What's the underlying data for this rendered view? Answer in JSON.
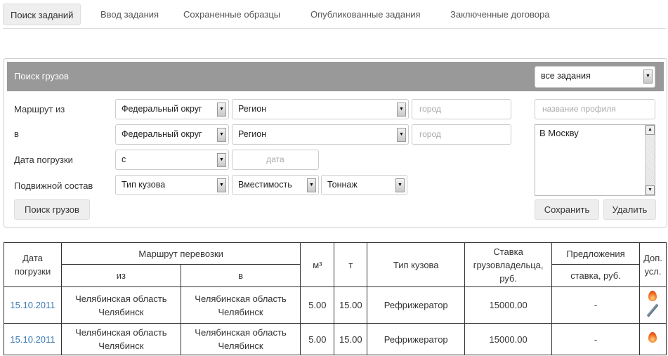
{
  "tabs": [
    "Поиск заданий",
    "Ввод задания",
    "Сохраненные образцы",
    "Опубликованные задания",
    "Заключенные договора"
  ],
  "panel": {
    "title": "Поиск грузов",
    "scope_select": "все задания",
    "labels": {
      "from": "Маршрут из",
      "to": "в",
      "date": "Дата погрузки",
      "rolling": "Подвижной состав"
    },
    "from": {
      "district": "Федеральный округ",
      "region": "Регион",
      "city_placeholder": "город"
    },
    "to": {
      "district": "Федеральный округ",
      "region": "Регион",
      "city_placeholder": "город"
    },
    "date": {
      "mode": "с",
      "placeholder": "дата"
    },
    "rolling": {
      "body": "Тип кузова",
      "capacity": "Вместимость",
      "tonnage": "Тоннаж"
    },
    "search_button": "Поиск грузов",
    "profile_placeholder": "название профиля",
    "profiles": "В Москву",
    "save_button": "Сохранить",
    "delete_button": "Удалить"
  },
  "table": {
    "headers": {
      "date": "Дата погрузки",
      "route": "Маршрут перевозки",
      "from": "из",
      "to": "в",
      "volume": "м³",
      "weight": "т",
      "body": "Тип кузова",
      "rate": "Ставка грузовладельца, руб.",
      "offers": "Предложения",
      "offers_rate": "ставка, руб.",
      "extra": "Доп. усл."
    },
    "rows": [
      {
        "date": "15.10.2011",
        "from_region": "Челябинская область",
        "from_city": "Челябинск",
        "to_region": "Челябинская область",
        "to_city": "Челябинск",
        "volume": "5.00",
        "weight": "15.00",
        "body": "Рефрижератор",
        "rate": "15000.00",
        "offer": "-",
        "icons": [
          "fire",
          "pencil"
        ]
      },
      {
        "date": "15.10.2011",
        "from_region": "Челябинская область",
        "from_city": "Челябинск",
        "to_region": "Челябинская область",
        "to_city": "Челябинск",
        "volume": "5.00",
        "weight": "15.00",
        "body": "Рефрижератор",
        "rate": "15000.00",
        "offer": "-",
        "icons": [
          "fire"
        ]
      }
    ]
  }
}
